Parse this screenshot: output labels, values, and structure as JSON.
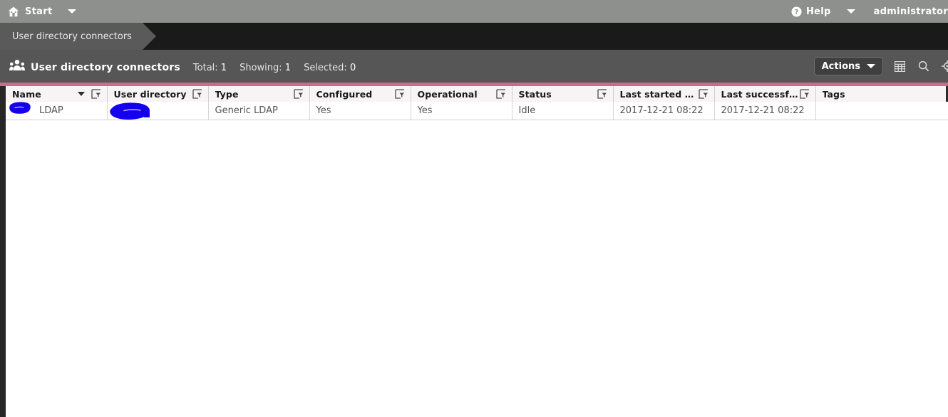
{
  "topbar": {
    "home_icon": "home-icon",
    "start_label": "Start",
    "start_caret_icon": "chevron-down-icon",
    "help_icon": "help-circle-icon",
    "help_label": "Help",
    "help_caret_icon": "chevron-down-icon",
    "user_label": "administrator"
  },
  "breadcrumb": {
    "items": [
      {
        "label": "User directory connectors"
      }
    ]
  },
  "toolbar": {
    "icon": "users-group-icon",
    "title": "User directory connectors",
    "stats": [
      {
        "label": "Total:",
        "value": "1"
      },
      {
        "label": "Showing:",
        "value": "1"
      },
      {
        "label": "Selected:",
        "value": "0"
      }
    ],
    "actions_label": "Actions",
    "actions_caret_icon": "chevron-down-icon",
    "icons": [
      {
        "name": "table-view-icon"
      },
      {
        "name": "search-icon"
      },
      {
        "name": "settings-gear-icon"
      }
    ]
  },
  "table": {
    "columns": [
      {
        "label": "Name",
        "sorted": "desc",
        "filter": true
      },
      {
        "label": "User directory",
        "sorted": "",
        "filter": true
      },
      {
        "label": "Type",
        "sorted": "",
        "filter": true
      },
      {
        "label": "Configured",
        "sorted": "",
        "filter": true
      },
      {
        "label": "Operational",
        "sorted": "",
        "filter": true
      },
      {
        "label": "Status",
        "sorted": "",
        "filter": true
      },
      {
        "label": "Last started sync",
        "sorted": "",
        "filter": true
      },
      {
        "label": "Last successfu...",
        "sorted": "",
        "filter": true
      },
      {
        "label": "Tags",
        "sorted": "",
        "filter": false
      }
    ],
    "rows": [
      {
        "name": "LDAP",
        "user_directory": "",
        "type": "Generic LDAP",
        "configured": "Yes",
        "operational": "Yes",
        "status": "Idle",
        "last_started_sync": "2017-12-21 08:22",
        "last_successful_sync": "2017-12-21 08:22",
        "tags": ""
      }
    ]
  },
  "annotations": {
    "redaction_color": "#1500ee",
    "marks": [
      {
        "name": "redaction-mark-name-cell"
      },
      {
        "name": "redaction-mark-user-directory-cell"
      }
    ]
  },
  "colors": {
    "topbar_bg": "#8e908e",
    "breadcrumb_bg": "#1a1a1a",
    "crumb_tab_bg": "#5a5a5a",
    "toolbar_bg": "#565656",
    "accent": "#cc6b88",
    "header_bg": "#f8f4f6",
    "gutter": "#262626"
  }
}
